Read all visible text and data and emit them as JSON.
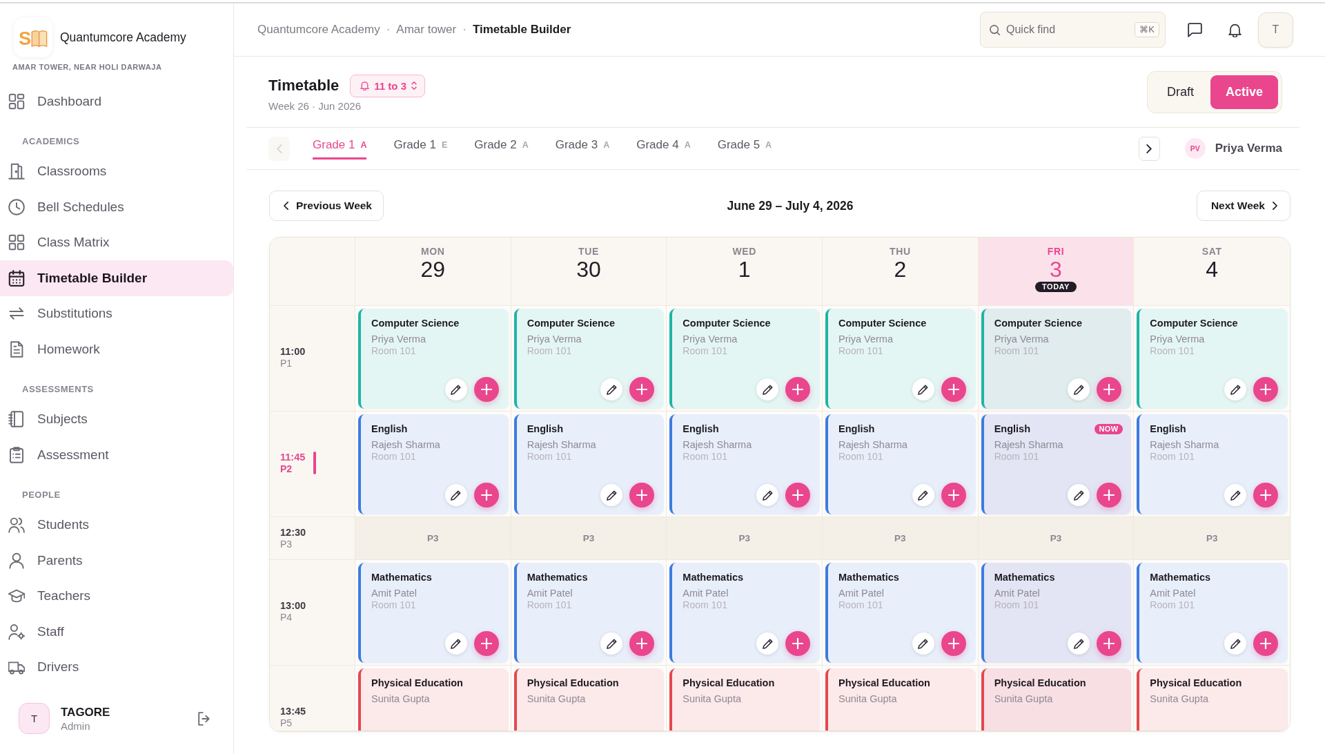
{
  "sidebar": {
    "school": {
      "logo_letter": "S",
      "name": "Quantumcore Academy",
      "address": "AMAR TOWER, NEAR HOLI DARWAJA"
    },
    "sections": [
      {
        "items": [
          {
            "label": "Dashboard",
            "selected": false
          }
        ]
      },
      {
        "heading": "ACADEMICS",
        "items": [
          {
            "label": "Classrooms",
            "selected": false
          },
          {
            "label": "Bell Schedules",
            "selected": false
          },
          {
            "label": "Class Matrix",
            "selected": false
          },
          {
            "label": "Timetable Builder",
            "selected": true
          },
          {
            "label": "Substitutions",
            "selected": false
          },
          {
            "label": "Homework",
            "selected": false
          }
        ]
      },
      {
        "heading": "ASSESSMENTS",
        "items": [
          {
            "label": "Subjects",
            "selected": false
          },
          {
            "label": "Assessment",
            "selected": false
          }
        ]
      },
      {
        "heading": "PEOPLE",
        "items": [
          {
            "label": "Students",
            "selected": false
          },
          {
            "label": "Parents",
            "selected": false
          },
          {
            "label": "Teachers",
            "selected": false
          },
          {
            "label": "Staff",
            "selected": false
          },
          {
            "label": "Drivers",
            "selected": false
          }
        ]
      }
    ],
    "user": {
      "initial": "T",
      "name": "TAGORE",
      "role": "Admin"
    }
  },
  "top_bar": {
    "breadcrumbs": [
      "Quantumcore Academy",
      "Amar tower",
      "Timetable Builder"
    ],
    "separator": "·",
    "search": {
      "placeholder": "Quick find",
      "shortcut": "⌘K"
    },
    "account_initial": "T"
  },
  "page_header": {
    "title": "Timetable",
    "schedule": "11 to 3",
    "subtitle": "Week 26 · Jun 2026",
    "status_options": [
      {
        "label": "Draft",
        "selected": false
      },
      {
        "label": "Active",
        "selected": true
      }
    ]
  },
  "class_tabs": {
    "scroll_left_disabled": true,
    "scroll_right_disabled": false,
    "tabs": [
      {
        "label": "Grade 1",
        "section": "A",
        "selected": true
      },
      {
        "label": "Grade 1",
        "section": "E",
        "selected": false
      },
      {
        "label": "Grade 2",
        "section": "A",
        "selected": false
      },
      {
        "label": "Grade 3",
        "section": "A",
        "selected": false
      },
      {
        "label": "Grade 4",
        "section": "A",
        "selected": false
      },
      {
        "label": "Grade 5",
        "section": "A",
        "selected": false
      }
    ],
    "teacher": {
      "initials": "PV",
      "name": "Priya Verma"
    }
  },
  "week_nav": {
    "previous": "Previous Week",
    "range": "June 29 – July 4, 2026",
    "next": "Next Week"
  },
  "timetable": {
    "days": [
      {
        "name": "MON",
        "date": "29",
        "today": false
      },
      {
        "name": "TUE",
        "date": "30",
        "today": false
      },
      {
        "name": "WED",
        "date": "1",
        "today": false
      },
      {
        "name": "THU",
        "date": "2",
        "today": false
      },
      {
        "name": "FRI",
        "date": "3",
        "today": true,
        "badge": "TODAY"
      },
      {
        "name": "SAT",
        "date": "4",
        "today": false
      }
    ],
    "rows": [
      {
        "time": "11:00",
        "period": "P1",
        "kind": "lesson",
        "current": false,
        "cells": [
          {
            "subject": "Computer Science",
            "teacher": "Priya Verma",
            "room": "Room 101",
            "color": "#1fb5a5",
            "actions": true
          },
          {
            "subject": "Computer Science",
            "teacher": "Priya Verma",
            "room": "Room 101",
            "color": "#1fb5a5",
            "actions": true
          },
          {
            "subject": "Computer Science",
            "teacher": "Priya Verma",
            "room": "Room 101",
            "color": "#1fb5a5",
            "actions": true
          },
          {
            "subject": "Computer Science",
            "teacher": "Priya Verma",
            "room": "Room 101",
            "color": "#1fb5a5",
            "actions": true
          },
          {
            "subject": "Computer Science",
            "teacher": "Priya Verma",
            "room": "Room 101",
            "color": "#1fb5a5",
            "actions": true
          },
          {
            "subject": "Computer Science",
            "teacher": "Priya Verma",
            "room": "Room 101",
            "color": "#1fb5a5",
            "actions": true
          }
        ]
      },
      {
        "time": "11:45",
        "period": "P2",
        "kind": "lesson",
        "current": true,
        "cells": [
          {
            "subject": "English",
            "teacher": "Rajesh Sharma",
            "room": "Room 101",
            "color": "#3d7be0",
            "actions": true
          },
          {
            "subject": "English",
            "teacher": "Rajesh Sharma",
            "room": "Room 101",
            "color": "#3d7be0",
            "actions": true
          },
          {
            "subject": "English",
            "teacher": "Rajesh Sharma",
            "room": "Room 101",
            "color": "#3d7be0",
            "actions": true
          },
          {
            "subject": "English",
            "teacher": "Rajesh Sharma",
            "room": "Room 101",
            "color": "#3d7be0",
            "actions": true
          },
          {
            "subject": "English",
            "teacher": "Rajesh Sharma",
            "room": "Room 101",
            "color": "#3d7be0",
            "actions": true,
            "badge": "NOW"
          },
          {
            "subject": "English",
            "teacher": "Rajesh Sharma",
            "room": "Room 101",
            "color": "#3d7be0",
            "actions": true
          }
        ]
      },
      {
        "time": "12:30",
        "period": "P3",
        "kind": "break",
        "current": false,
        "cells": [
          {
            "label": "P3"
          },
          {
            "label": "P3"
          },
          {
            "label": "P3"
          },
          {
            "label": "P3"
          },
          {
            "label": "P3"
          },
          {
            "label": "P3"
          }
        ]
      },
      {
        "time": "13:00",
        "period": "P4",
        "kind": "lesson",
        "current": false,
        "cells": [
          {
            "subject": "Mathematics",
            "teacher": "Amit Patel",
            "room": "Room 101",
            "color": "#3d7be0",
            "actions": true
          },
          {
            "subject": "Mathematics",
            "teacher": "Amit Patel",
            "room": "Room 101",
            "color": "#3d7be0",
            "actions": true
          },
          {
            "subject": "Mathematics",
            "teacher": "Amit Patel",
            "room": "Room 101",
            "color": "#3d7be0",
            "actions": true
          },
          {
            "subject": "Mathematics",
            "teacher": "Amit Patel",
            "room": "Room 101",
            "color": "#3d7be0",
            "actions": true
          },
          {
            "subject": "Mathematics",
            "teacher": "Amit Patel",
            "room": "Room 101",
            "color": "#3d7be0",
            "actions": true
          },
          {
            "subject": "Mathematics",
            "teacher": "Amit Patel",
            "room": "Room 101",
            "color": "#3d7be0",
            "actions": true
          }
        ]
      },
      {
        "time": "13:45",
        "period": "P5",
        "kind": "lesson",
        "current": false,
        "cells": [
          {
            "subject": "Physical Education",
            "teacher": "Sunita Gupta",
            "color": "#e5484d",
            "actions": false
          },
          {
            "subject": "Physical Education",
            "teacher": "Sunita Gupta",
            "color": "#e5484d",
            "actions": false
          },
          {
            "subject": "Physical Education",
            "teacher": "Sunita Gupta",
            "color": "#e5484d",
            "actions": false
          },
          {
            "subject": "Physical Education",
            "teacher": "Sunita Gupta",
            "color": "#e5484d",
            "actions": false
          },
          {
            "subject": "Physical Education",
            "teacher": "Sunita Gupta",
            "color": "#e5484d",
            "actions": false
          },
          {
            "subject": "Physical Education",
            "teacher": "Sunita Gupta",
            "color": "#e5484d",
            "actions": false
          }
        ]
      }
    ]
  }
}
